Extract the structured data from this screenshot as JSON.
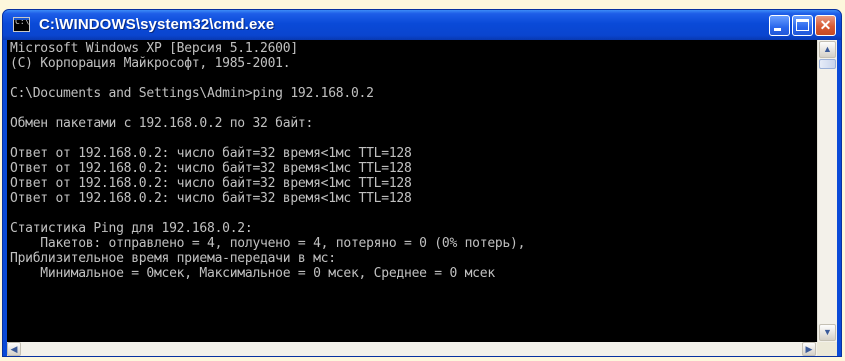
{
  "window": {
    "title": "C:\\WINDOWS\\system32\\cmd.exe",
    "icon": "cmd-icon",
    "icon_glyph": "C:\\"
  },
  "title_buttons": {
    "minimize_icon": "minimize-icon",
    "maximize_icon": "maximize-icon",
    "close_icon": "close-icon",
    "close_glyph": "✕"
  },
  "console": {
    "lines": [
      "Microsoft Windows XP [Версия 5.1.2600]",
      "(С) Корпорация Майкрософт, 1985-2001.",
      "",
      "C:\\Documents and Settings\\Admin>ping 192.168.0.2",
      "",
      "Обмен пакетами с 192.168.0.2 по 32 байт:",
      "",
      "Ответ от 192.168.0.2: число байт=32 время<1мс TTL=128",
      "Ответ от 192.168.0.2: число байт=32 время<1мс TTL=128",
      "Ответ от 192.168.0.2: число байт=32 время<1мс TTL=128",
      "Ответ от 192.168.0.2: число байт=32 время<1мс TTL=128",
      "",
      "Статистика Ping для 192.168.0.2:",
      "    Пакетов: отправлено = 4, получено = 4, потеряно = 0 (0% потерь),",
      "Приблизительное время приема-передачи в мс:",
      "    Минимальное = 0мсек, Максимальное = 0 мсек, Среднее = 0 мсек"
    ]
  },
  "scrollbars": {
    "up_glyph": "▲",
    "down_glyph": "▼",
    "left_glyph": "◀",
    "right_glyph": "▶"
  },
  "colors": {
    "titlebar": "#0a4ad8",
    "console_bg": "#000000",
    "console_text": "#c0c0c0",
    "close_button": "#d85a34"
  }
}
